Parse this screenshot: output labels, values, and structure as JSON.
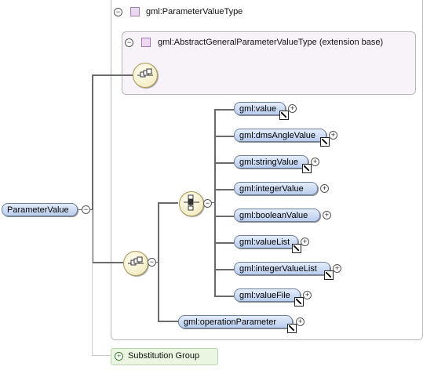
{
  "root": {
    "label": "ParameterValue"
  },
  "type_box": {
    "label": "gml:ParameterValueType"
  },
  "base_box": {
    "label": "gml:AbstractGeneralParameterValueType (extension base)"
  },
  "choice_children": [
    {
      "label": "gml:value",
      "has_ref": true
    },
    {
      "label": "gml:dmsAngleValue",
      "has_ref": true
    },
    {
      "label": "gml:stringValue",
      "has_ref": true
    },
    {
      "label": "gml:integerValue",
      "has_ref": false
    },
    {
      "label": "gml:booleanValue",
      "has_ref": false
    },
    {
      "label": "gml:valueList",
      "has_ref": true
    },
    {
      "label": "gml:integerValueList",
      "has_ref": true
    },
    {
      "label": "gml:valueFile",
      "has_ref": true
    }
  ],
  "sequence_child": {
    "label": "gml:operationParameter",
    "has_ref": true
  },
  "substitution": {
    "label": "Substitution Group"
  },
  "colors": {
    "element_fill": "#c9d9f3",
    "compositor_fill": "#f5edc8",
    "type_fill": "#f8f3f8",
    "substitution_fill": "#eaf6e1"
  }
}
